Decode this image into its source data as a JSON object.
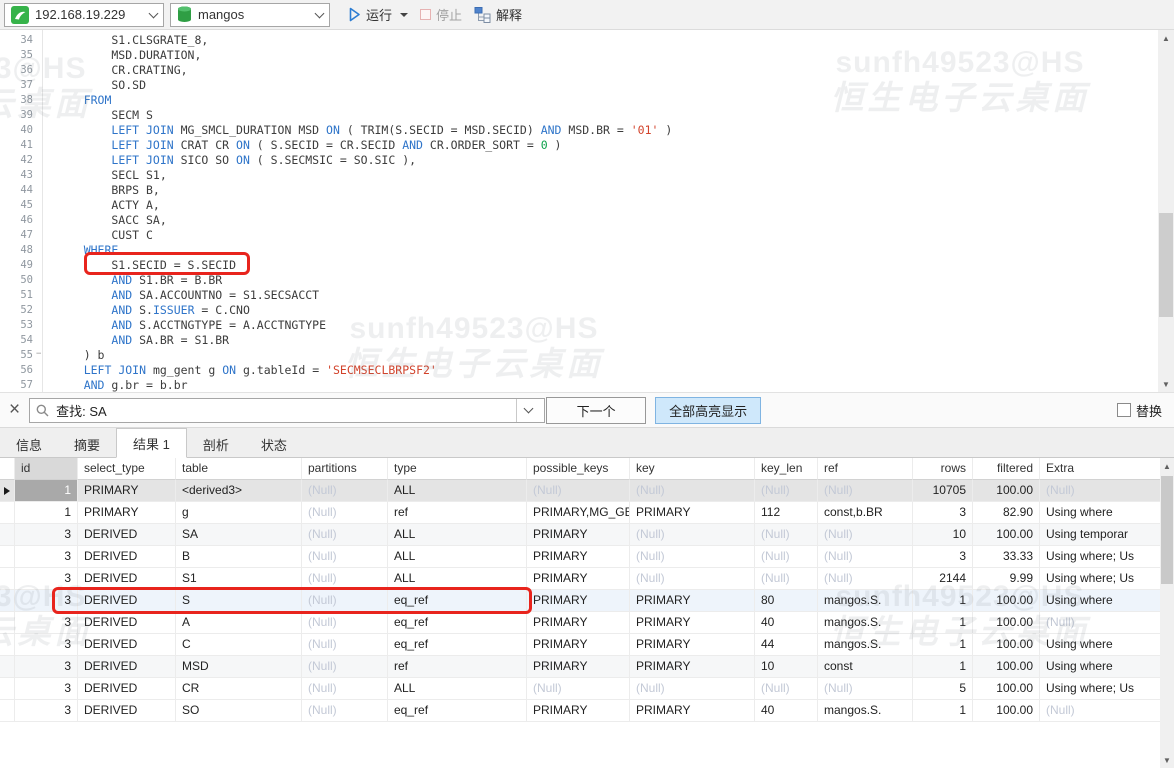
{
  "toolbar": {
    "connection": {
      "value": "192.168.19.229"
    },
    "database": {
      "value": "mangos"
    },
    "run_label": "运行",
    "stop_label": "停止",
    "explain_label": "解释"
  },
  "watermark": {
    "line1": "sunfh49523@HS",
    "line2": "恒生电子云桌面"
  },
  "editor": {
    "boxed_line": 49,
    "lines": [
      {
        "n": 34,
        "t": [
          [
            "        S1.CLSGRATE_8,",
            "p"
          ]
        ]
      },
      {
        "n": 35,
        "t": [
          [
            "        MSD.DURATION,",
            "p"
          ]
        ]
      },
      {
        "n": 36,
        "t": [
          [
            "        CR.CRATING,",
            "p"
          ]
        ]
      },
      {
        "n": 37,
        "t": [
          [
            "        SO.SD",
            "p"
          ]
        ]
      },
      {
        "n": 38,
        "t": [
          [
            "    ",
            "p"
          ],
          [
            "FROM",
            "k"
          ]
        ]
      },
      {
        "n": 39,
        "t": [
          [
            "        SECM S",
            "p"
          ]
        ]
      },
      {
        "n": 40,
        "t": [
          [
            "        ",
            "p"
          ],
          [
            "LEFT JOIN",
            "k"
          ],
          [
            " MG_SMCL_DURATION MSD ",
            "p"
          ],
          [
            "ON",
            "k"
          ],
          [
            " ( TRIM(S.SECID = MSD.SECID) ",
            "p"
          ],
          [
            "AND",
            "k"
          ],
          [
            " MSD.BR = ",
            "p"
          ],
          [
            "'01'",
            "s"
          ],
          [
            " )",
            "p"
          ]
        ]
      },
      {
        "n": 41,
        "t": [
          [
            "        ",
            "p"
          ],
          [
            "LEFT JOIN",
            "k"
          ],
          [
            " CRAT CR ",
            "p"
          ],
          [
            "ON",
            "k"
          ],
          [
            " ( S.SECID = CR.SECID ",
            "p"
          ],
          [
            "AND",
            "k"
          ],
          [
            " CR.ORDER_SORT = ",
            "p"
          ],
          [
            "0",
            "n"
          ],
          [
            " )",
            "p"
          ]
        ]
      },
      {
        "n": 42,
        "t": [
          [
            "        ",
            "p"
          ],
          [
            "LEFT JOIN",
            "k"
          ],
          [
            " SICO SO ",
            "p"
          ],
          [
            "ON",
            "k"
          ],
          [
            " ( S.SECMSIC = SO.SIC ),",
            "p"
          ]
        ]
      },
      {
        "n": 43,
        "t": [
          [
            "        SECL S1,",
            "p"
          ]
        ]
      },
      {
        "n": 44,
        "t": [
          [
            "        BRPS B,",
            "p"
          ]
        ]
      },
      {
        "n": 45,
        "t": [
          [
            "        ACTY A,",
            "p"
          ]
        ]
      },
      {
        "n": 46,
        "t": [
          [
            "        SACC SA,",
            "p"
          ]
        ]
      },
      {
        "n": 47,
        "t": [
          [
            "        CUST C",
            "p"
          ]
        ]
      },
      {
        "n": 48,
        "t": [
          [
            "    ",
            "p"
          ],
          [
            "WHERE",
            "k"
          ]
        ]
      },
      {
        "n": 49,
        "t": [
          [
            "        S1.SECID = S.SECID",
            "p"
          ]
        ]
      },
      {
        "n": 50,
        "t": [
          [
            "        ",
            "p"
          ],
          [
            "AND",
            "k"
          ],
          [
            " S1.BR = B.BR",
            "p"
          ]
        ]
      },
      {
        "n": 51,
        "t": [
          [
            "        ",
            "p"
          ],
          [
            "AND",
            "k"
          ],
          [
            " SA.ACCOUNTNO = S1.SECSACCT",
            "p"
          ]
        ]
      },
      {
        "n": 52,
        "t": [
          [
            "        ",
            "p"
          ],
          [
            "AND",
            "k"
          ],
          [
            " S.",
            "p"
          ],
          [
            "ISSUER",
            "k"
          ],
          [
            " = C.CNO",
            "p"
          ]
        ]
      },
      {
        "n": 53,
        "t": [
          [
            "        ",
            "p"
          ],
          [
            "AND",
            "k"
          ],
          [
            " S.ACCTNGTYPE = A.ACCTNGTYPE",
            "p"
          ]
        ]
      },
      {
        "n": 54,
        "t": [
          [
            "        ",
            "p"
          ],
          [
            "AND",
            "k"
          ],
          [
            " SA.BR = S1.BR",
            "p"
          ]
        ]
      },
      {
        "n": 55,
        "fold": true,
        "t": [
          [
            "    ) b",
            "p"
          ]
        ]
      },
      {
        "n": 56,
        "t": [
          [
            "    ",
            "p"
          ],
          [
            "LEFT JOIN",
            "k"
          ],
          [
            " mg_gent g ",
            "p"
          ],
          [
            "ON",
            "k"
          ],
          [
            " g.tableId = ",
            "p"
          ],
          [
            "'SECMSECLBRPSF2'",
            "s"
          ]
        ]
      },
      {
        "n": 57,
        "t": [
          [
            "    ",
            "p"
          ],
          [
            "AND",
            "k"
          ],
          [
            " g.br = b.br",
            "p"
          ]
        ]
      }
    ]
  },
  "search": {
    "query": "查找: SA",
    "next_label": "下一个",
    "highlight_all_label": "全部高亮显示",
    "replace_label": "替换"
  },
  "tabs": {
    "items": [
      "信息",
      "摘要",
      "结果 1",
      "剖析",
      "状态"
    ],
    "active_index": 2
  },
  "result_table": {
    "columns": [
      "id",
      "select_type",
      "table",
      "partitions",
      "type",
      "possible_keys",
      "key",
      "key_len",
      "ref",
      "rows",
      "filtered",
      "Extra"
    ],
    "selected_row": 0,
    "shaded_rows": [
      2,
      8
    ],
    "tinted_rows": [
      5
    ],
    "boxed_row": 5,
    "rows": [
      [
        "1",
        "PRIMARY",
        "<derived3>",
        "(Null)",
        "ALL",
        "(Null)",
        "(Null)",
        "(Null)",
        "(Null)",
        "10705",
        "100.00",
        "(Null)"
      ],
      [
        "1",
        "PRIMARY",
        "g",
        "(Null)",
        "ref",
        "PRIMARY,MG_GE",
        "PRIMARY",
        "112",
        "const,b.BR",
        "3",
        "82.90",
        "Using where"
      ],
      [
        "3",
        "DERIVED",
        "SA",
        "(Null)",
        "ALL",
        "PRIMARY",
        "(Null)",
        "(Null)",
        "(Null)",
        "10",
        "100.00",
        "Using temporar"
      ],
      [
        "3",
        "DERIVED",
        "B",
        "(Null)",
        "ALL",
        "PRIMARY",
        "(Null)",
        "(Null)",
        "(Null)",
        "3",
        "33.33",
        "Using where; Us"
      ],
      [
        "3",
        "DERIVED",
        "S1",
        "(Null)",
        "ALL",
        "PRIMARY",
        "(Null)",
        "(Null)",
        "(Null)",
        "2144",
        "9.99",
        "Using where; Us"
      ],
      [
        "3",
        "DERIVED",
        "S",
        "(Null)",
        "eq_ref",
        "PRIMARY",
        "PRIMARY",
        "80",
        "mangos.S.",
        "1",
        "100.00",
        "Using where"
      ],
      [
        "3",
        "DERIVED",
        "A",
        "(Null)",
        "eq_ref",
        "PRIMARY",
        "PRIMARY",
        "40",
        "mangos.S.",
        "1",
        "100.00",
        "(Null)"
      ],
      [
        "3",
        "DERIVED",
        "C",
        "(Null)",
        "eq_ref",
        "PRIMARY",
        "PRIMARY",
        "44",
        "mangos.S.",
        "1",
        "100.00",
        "Using where"
      ],
      [
        "3",
        "DERIVED",
        "MSD",
        "(Null)",
        "ref",
        "PRIMARY",
        "PRIMARY",
        "10",
        "const",
        "1",
        "100.00",
        "Using where"
      ],
      [
        "3",
        "DERIVED",
        "CR",
        "(Null)",
        "ALL",
        "(Null)",
        "(Null)",
        "(Null)",
        "(Null)",
        "5",
        "100.00",
        "Using where; Us"
      ],
      [
        "3",
        "DERIVED",
        "SO",
        "(Null)",
        "eq_ref",
        "PRIMARY",
        "PRIMARY",
        "40",
        "mangos.S.",
        "1",
        "100.00",
        "(Null)"
      ]
    ]
  }
}
